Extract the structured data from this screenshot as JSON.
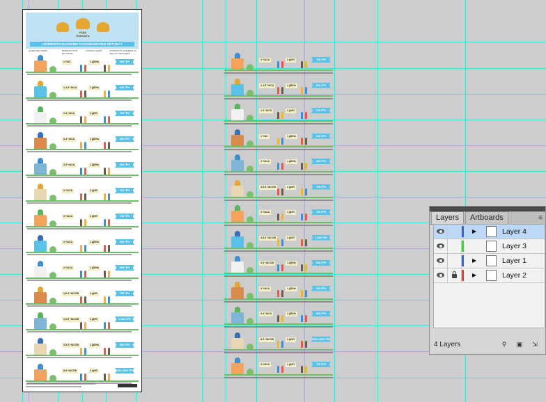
{
  "artboard": {
    "header_line1": "КУДА",
    "header_line2": "ПОЕХАТЬ",
    "banner": "«ЮЖНОУРАЛЬСКИМИ ПАЛОМНИКАМИ ЛЕТОМ?»",
    "col_headers": [
      "НАЗВАНИЕ ХРАМА",
      "ВРЕМЯ В ПУТИ ДО ХРАМА",
      "СКОЛЬКО ДНЕЙ",
      "СТОИМОСТЬ ПОЕЗДКИ НА ОДНОГО ЧЕЛОВЕКА"
    ],
    "rows": [
      {
        "time": "1 ЧАС",
        "days": "1 ДЕНЬ",
        "price": "500 ГРН"
      },
      {
        "time": "1-1,5 ЧАСА",
        "days": "1 ДЕНЬ",
        "price": "600 ГРН"
      },
      {
        "time": "2-3 ЧАСА",
        "days": "2 ДНЯ",
        "price": "700 ГРН"
      },
      {
        "time": "3-4 ЧАСА",
        "days": "1 ДЕНЬ",
        "price": "800 ГРН"
      },
      {
        "time": "3-5 ЧАСА",
        "days": "1 ДЕНЬ",
        "price": "600 ГРН"
      },
      {
        "time": "3 ЧАСА",
        "days": "2 ДНЯ",
        "price": "700 ГРН"
      },
      {
        "time": "3 ЧАСА",
        "days": "2 ДНЯ",
        "price": "700 ГРН"
      },
      {
        "time": "4 ЧАСА",
        "days": "1 ДЕНЬ",
        "price": "600 ГРН"
      },
      {
        "time": "4 ЧАСА",
        "days": "1 ДЕНЬ",
        "price": "800 ГРН"
      },
      {
        "time": "4,5-5 ЧАСОВ",
        "days": "2 ДНЯ",
        "price": "750 ГРН"
      },
      {
        "time": "4,5-5 ЧАСОВ",
        "days": "2 ДНЯ",
        "price": "1 500 ГРН"
      },
      {
        "time": "4,5-5 ЧАСОВ",
        "days": "1 ДЕНЬ",
        "price": "800 ГРН"
      },
      {
        "time": "8-9 ЧАСОВ",
        "days": "2 ДНЯ",
        "price": "1500-1800 ГРН"
      }
    ]
  },
  "strips": [
    {
      "time": "2 ЧАСА",
      "days": "2 ДНЯ",
      "price": "700 ГРН"
    },
    {
      "time": "1-1,5 ЧАСА",
      "days": "1 ДЕНЬ",
      "price": "600 ГРН"
    },
    {
      "time": "2-3 ЧАСА",
      "days": "2 ДНЯ",
      "price": "700 ГРН"
    },
    {
      "time": "1 ЧАС",
      "days": "1 ДЕНЬ",
      "price": "600 ГРН"
    },
    {
      "time": "3 ЧАСА",
      "days": "1 ДЕНЬ",
      "price": "600 ГРН"
    },
    {
      "time": "4,5-5 ЧАСОВ",
      "days": "2 ДНЯ",
      "price": "700 ГРН"
    },
    {
      "time": "3 ЧАСА",
      "days": "2 ДНЯ",
      "price": "700 ГРН"
    },
    {
      "time": "4,5-5 ЧАСОВ",
      "days": "2 ДНЯ",
      "price": "1 500 ГРН"
    },
    {
      "time": "3-5 ЧАСОВ",
      "days": "1 ДЕНЬ",
      "price": "600 ГРН"
    },
    {
      "time": "3 ЧАСА",
      "days": "1 ДЕНЬ",
      "price": "600 ГРН"
    },
    {
      "time": "3-4 ЧАСА",
      "days": "1 ДЕНЬ",
      "price": "800 ГРН"
    },
    {
      "time": "8-9 ЧАСОВ",
      "days": "2 ДНЯ",
      "price": "1500-1800 ГРН"
    },
    {
      "time": "3 ЧАСА",
      "days": "2 ДНЯ",
      "price": "700 ГРН"
    }
  ],
  "panel": {
    "tabs": [
      "Layers",
      "Artboards"
    ],
    "layers": [
      {
        "name": "Layer 4",
        "color": "#3a5fe0",
        "selected": true,
        "locked": false,
        "expandable": true
      },
      {
        "name": "Layer 3",
        "color": "#3fcf3f",
        "selected": false,
        "locked": false,
        "expandable": false
      },
      {
        "name": "Layer 1",
        "color": "#3a5fe0",
        "selected": false,
        "locked": false,
        "expandable": true
      },
      {
        "name": "Layer 2",
        "color": "#e04444",
        "selected": false,
        "locked": true,
        "expandable": true
      }
    ],
    "count_label": "4 Layers"
  }
}
